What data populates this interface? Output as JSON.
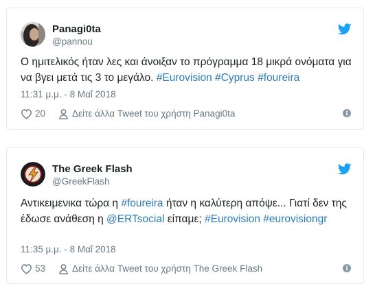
{
  "tweets": [
    {
      "name": "Panagi0ta",
      "handle": "@pannou",
      "text": [
        {
          "t": "Ο ημιτελικός ήταν λες και άνοιξαν το πρόγραμμα 18 μικρά ονόματα για να βγει μετά τις 3 το μεγάλο. ",
          "k": "plain"
        },
        {
          "t": "#Eurovision",
          "k": "hashtag"
        },
        {
          "t": " ",
          "k": "plain"
        },
        {
          "t": "#Cyprus",
          "k": "hashtag"
        },
        {
          "t": " ",
          "k": "plain"
        },
        {
          "t": "#foureira",
          "k": "hashtag"
        }
      ],
      "timestamp": "11:31 μ.μ. - 8 Μαΐ 2018",
      "likes": "20",
      "profile_link": "Δείτε άλλα Tweet του χρήστη Panagi0ta"
    },
    {
      "name": "The Greek Flash",
      "handle": "@GreekFlash",
      "text": [
        {
          "t": "Αντικειμενικα τώρα η ",
          "k": "plain"
        },
        {
          "t": "#foureira",
          "k": "hashtag"
        },
        {
          "t": " ήταν η καλύτερη απόψε... Γιατί δεν της έδωσε ανάθεση η ",
          "k": "plain"
        },
        {
          "t": "@ERTsocial",
          "k": "mention"
        },
        {
          "t": " είπαμε; ",
          "k": "plain"
        },
        {
          "t": "#Eurovision",
          "k": "hashtag"
        },
        {
          "t": " ",
          "k": "plain"
        },
        {
          "t": "#eurovisiongr",
          "k": "hashtag"
        }
      ],
      "timestamp": "11:35 μ.μ. - 8 Μαΐ 2018",
      "likes": "53",
      "profile_link": "Δείτε άλλα Tweet του χρήστη The Greek Flash"
    }
  ],
  "icons": {
    "brand": "twitter-bird-icon",
    "like": "heart-icon",
    "profile": "person-icon",
    "info": "info-icon"
  },
  "colors": {
    "link": "#2b7bb9",
    "brand": "#1da1f2",
    "muted": "#697882",
    "border": "#e1e8ed"
  }
}
